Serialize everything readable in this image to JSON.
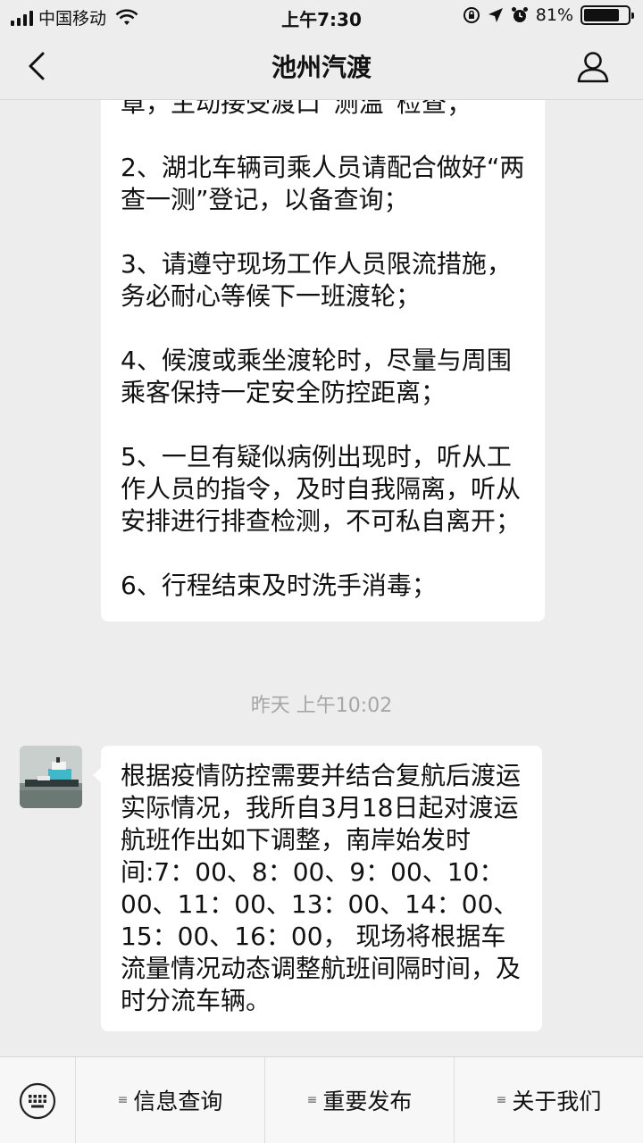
{
  "status_bar": {
    "carrier": "中国移动",
    "time": "上午7:30",
    "battery_percent": "81%",
    "battery_level": 0.81
  },
  "nav": {
    "title": "池州汽渡",
    "back_icon": "chevron-left-icon",
    "profile_icon": "person-icon"
  },
  "messages": {
    "first": {
      "partial_line": "章，主动接受渡口“测温”检查；",
      "items": [
        "2、湖北车辆司乘人员请配合做好“两查一测”登记，以备查询；",
        "3、请遵守现场工作人员限流措施，务必耐心等候下一班渡轮；",
        "4、候渡或乘坐渡轮时，尽量与周围乘客保持一定安全防控距离；",
        "5、一旦有疑似病例出现时，听从工作人员的指令，及时自我隔离，听从安排进行排查检测，不可私自离开；",
        "6、行程结束及时洗手消毒；"
      ]
    },
    "timestamp": "昨天 上午10:02",
    "second": {
      "text": "根据疫情防控需要并结合复航后渡运实际情况，我所自3月18日起对渡运航班作出如下调整，南岸始发时间:7：00、8：00、9：00、10：00、11：00、13：00、14：00、15：00、16：00， 现场将根据车流量情况动态调整航班间隔时间，及时分流车辆。"
    }
  },
  "bottom_menu": {
    "keyboard_icon": "keyboard-icon",
    "items": [
      {
        "label": "信息查询"
      },
      {
        "label": "重要发布"
      },
      {
        "label": "关于我们"
      }
    ]
  }
}
